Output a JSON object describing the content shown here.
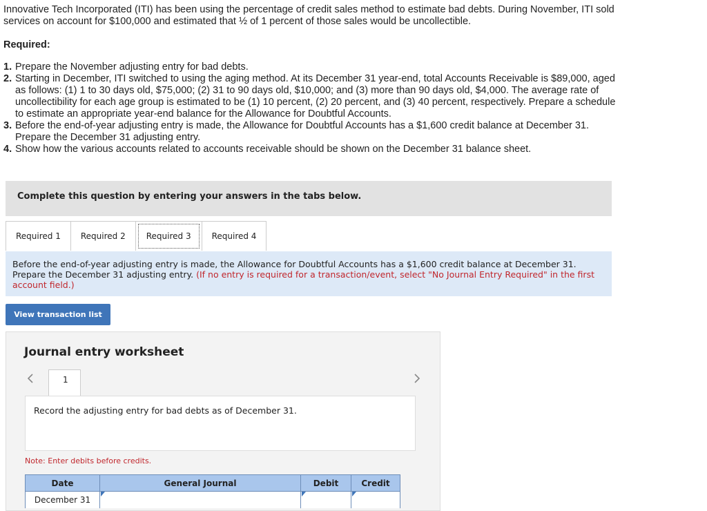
{
  "intro": "Innovative Tech Incorporated (ITI) has been using the percentage of credit sales method to estimate bad debts. During November, ITI sold services on account for $100,000 and estimated that ½ of 1 percent of those sales would be uncollectible.",
  "required_heading": "Required:",
  "requirements": [
    {
      "num": "1.",
      "text": "Prepare the November adjusting entry for bad debts."
    },
    {
      "num": "2.",
      "text": "Starting in December, ITI switched to using the aging method. At its December 31 year-end, total Accounts Receivable is $89,000, aged as follows: (1) 1 to 30 days old, $75,000; (2) 31 to 90 days old, $10,000; and (3) more than 90 days old, $4,000. The average rate of uncollectibility for each age group is estimated to be (1) 10 percent, (2) 20 percent, and (3) 40 percent, respectively. Prepare a schedule to estimate an appropriate year-end balance for the Allowance for Doubtful Accounts."
    },
    {
      "num": "3.",
      "text": "Before the end-of-year adjusting entry is made, the Allowance for Doubtful Accounts has a $1,600 credit balance at December 31. Prepare the December 31 adjusting entry."
    },
    {
      "num": "4.",
      "text": "Show how the various accounts related to accounts receivable should be shown on the December 31 balance sheet."
    }
  ],
  "banner": "Complete this question by entering your answers in the tabs below.",
  "tabs": [
    "Required 1",
    "Required 2",
    "Required 3",
    "Required 4"
  ],
  "active_tab": 2,
  "info_text": "Before the end-of-year adjusting entry is made, the Allowance for Doubtful Accounts has a $1,600 credit balance at December 31. Prepare the December 31 adjusting entry.",
  "info_note": "(If no entry is required for a transaction/event, select \"No Journal Entry Required\" in the first account field.)",
  "view_button": "View transaction list",
  "worksheet": {
    "title": "Journal entry worksheet",
    "entry_number": "1",
    "record_text": "Record the adjusting entry for bad debts as of December 31.",
    "note": "Note: Enter debits before credits.",
    "columns": [
      "Date",
      "General Journal",
      "Debit",
      "Credit"
    ],
    "rows": [
      {
        "date": "December 31",
        "general_journal": "",
        "debit": "",
        "credit": ""
      }
    ]
  },
  "icons": {
    "prev": "chevron-left-icon",
    "next": "chevron-right-icon"
  },
  "colors": {
    "accent": "#3f75b9",
    "info_bg": "#dde9f7",
    "note_red": "#c0262c",
    "table_header": "#a9c6ec"
  }
}
